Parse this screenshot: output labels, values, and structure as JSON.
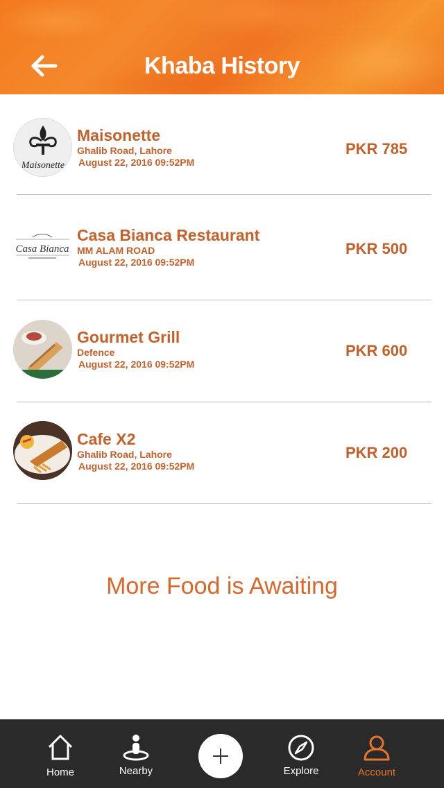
{
  "header": {
    "title": "Khaba History",
    "back_icon": "arrow-left-icon",
    "color": "#f47a1e"
  },
  "history": [
    {
      "name": "Maisonette",
      "address": "Ghalib Road, Lahore",
      "date": "August 22, 2016 09:52PM",
      "price": "PKR 785",
      "logo_text": "Maisonette"
    },
    {
      "name": "Casa Bianca Restaurant",
      "address": "MM ALAM ROAD",
      "date": "August 22, 2016 09:52PM",
      "price": "PKR 500",
      "logo_text": "Casa Bianca"
    },
    {
      "name": "Gourmet Grill",
      "address": "Defence",
      "date": "August 22, 2016 09:52PM",
      "price": "PKR 600"
    },
    {
      "name": "Cafe X2",
      "address": "Ghalib Road, Lahore",
      "date": "August 22, 2016 09:52PM",
      "price": "PKR 200"
    }
  ],
  "footer_message": "More Food is Awaiting",
  "tabbar": {
    "items": [
      {
        "label": "Home",
        "icon": "home-icon",
        "active": false
      },
      {
        "label": "Nearby",
        "icon": "location-pin-icon",
        "active": false
      },
      {
        "label": "",
        "icon": "plus-icon",
        "active": false
      },
      {
        "label": "Explore",
        "icon": "compass-icon",
        "active": false
      },
      {
        "label": "Account",
        "icon": "user-icon",
        "active": true
      }
    ],
    "active_color": "#e8752b"
  },
  "colors": {
    "accent": "#c4602a",
    "tabbar_bg": "#2a2a2a"
  }
}
